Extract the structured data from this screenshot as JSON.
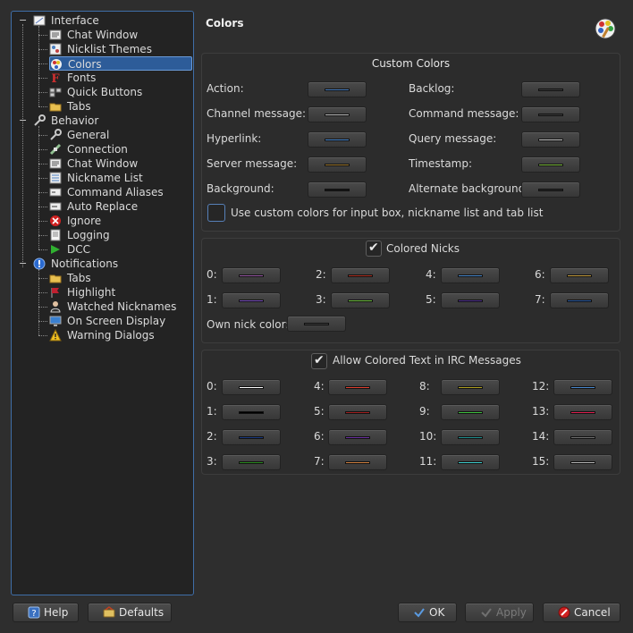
{
  "tree": {
    "items": [
      {
        "label": "Interface",
        "level": 0,
        "icon": "interface-window-icon"
      },
      {
        "label": "Chat Window",
        "level": 1,
        "icon": "chat-window-icon"
      },
      {
        "label": "Nicklist Themes",
        "level": 1,
        "icon": "nicklist-themes-icon"
      },
      {
        "label": "Colors",
        "level": 1,
        "icon": "colors-palette-icon",
        "selected": true
      },
      {
        "label": "Fonts",
        "level": 1,
        "icon": "fonts-icon"
      },
      {
        "label": "Quick Buttons",
        "level": 1,
        "icon": "quick-buttons-icon"
      },
      {
        "label": "Tabs",
        "level": 1,
        "icon": "tabs-folder-icon"
      },
      {
        "label": "Behavior",
        "level": 0,
        "icon": "wrench-icon"
      },
      {
        "label": "General",
        "level": 1,
        "icon": "wrench-icon"
      },
      {
        "label": "Connection",
        "level": 1,
        "icon": "connection-icon"
      },
      {
        "label": "Chat Window",
        "level": 1,
        "icon": "chat-window-icon"
      },
      {
        "label": "Nickname List",
        "level": 1,
        "icon": "nickname-list-icon"
      },
      {
        "label": "Command Aliases",
        "level": 1,
        "icon": "command-aliases-icon"
      },
      {
        "label": "Auto Replace",
        "level": 1,
        "icon": "auto-replace-icon"
      },
      {
        "label": "Ignore",
        "level": 1,
        "icon": "ignore-icon"
      },
      {
        "label": "Logging",
        "level": 1,
        "icon": "logging-icon"
      },
      {
        "label": "DCC",
        "level": 1,
        "icon": "dcc-arrow-icon"
      },
      {
        "label": "Notifications",
        "level": 0,
        "icon": "notifications-info-icon"
      },
      {
        "label": "Tabs",
        "level": 1,
        "icon": "tabs-folder-icon"
      },
      {
        "label": "Highlight",
        "level": 1,
        "icon": "highlight-flag-icon"
      },
      {
        "label": "Watched Nicknames",
        "level": 1,
        "icon": "watched-nicknames-icon"
      },
      {
        "label": "On Screen Display",
        "level": 1,
        "icon": "monitor-icon"
      },
      {
        "label": "Warning Dialogs",
        "level": 1,
        "icon": "warning-icon"
      }
    ]
  },
  "page": {
    "title": "Colors",
    "icon": "colors-palette-icon"
  },
  "custom_colors": {
    "title": "Custom Colors",
    "left": [
      {
        "label": "Action:",
        "color": "#4a7fc0"
      },
      {
        "label": "Channel message:",
        "color": "#c0c0c0"
      },
      {
        "label": "Hyperlink:",
        "color": "#4a8ad0"
      },
      {
        "label": "Server message:",
        "color": "#a07a30"
      },
      {
        "label": "Background:",
        "color": "#151515"
      }
    ],
    "right": [
      {
        "label": "Backlog:",
        "color": "#3a3a3a"
      },
      {
        "label": "Command message:",
        "color": "#3a3a3a"
      },
      {
        "label": "Query message:",
        "color": "#c8c8c8"
      },
      {
        "label": "Timestamp:",
        "color": "#7fbf40"
      },
      {
        "label": "Alternate background:",
        "color": "#262626"
      }
    ],
    "custom_checkbox_label": "Use custom colors for input box, nickname list and tab list",
    "custom_checkbox_checked": false
  },
  "colored_nicks": {
    "title": "Colored Nicks",
    "checked": true,
    "nicks": [
      {
        "label": "0:",
        "color": "#9a5aa8"
      },
      {
        "label": "1:",
        "color": "#7a50c0"
      },
      {
        "label": "2:",
        "color": "#b03020"
      },
      {
        "label": "3:",
        "color": "#70c040"
      },
      {
        "label": "4:",
        "color": "#4a8ad0"
      },
      {
        "label": "5:",
        "color": "#503090"
      },
      {
        "label": "6:",
        "color": "#c8a040"
      },
      {
        "label": "7:",
        "color": "#2a5aa0"
      }
    ],
    "own_label": "Own nick color:",
    "own_color": "#3a3a3a"
  },
  "irc_colors": {
    "title": "Allow Colored Text in IRC Messages",
    "checked": true,
    "colors": [
      {
        "label": "0:",
        "color": "#ffffff"
      },
      {
        "label": "1:",
        "color": "#000000"
      },
      {
        "label": "2:",
        "color": "#1a3a80"
      },
      {
        "label": "3:",
        "color": "#2a8a20"
      },
      {
        "label": "4:",
        "color": "#e04030"
      },
      {
        "label": "5:",
        "color": "#a02020"
      },
      {
        "label": "6:",
        "color": "#6a30a0"
      },
      {
        "label": "7:",
        "color": "#d08040"
      },
      {
        "label": "8:",
        "color": "#b0a020"
      },
      {
        "label": "9:",
        "color": "#40c040"
      },
      {
        "label": "10:",
        "color": "#209090"
      },
      {
        "label": "11:",
        "color": "#40d0d0"
      },
      {
        "label": "12:",
        "color": "#4a8ad0"
      },
      {
        "label": "13:",
        "color": "#e02050"
      },
      {
        "label": "14:",
        "color": "#707070"
      },
      {
        "label": "15:",
        "color": "#b8b8b8"
      }
    ]
  },
  "buttons": {
    "help": "Help",
    "defaults": "Defaults",
    "ok": "OK",
    "apply": "Apply",
    "cancel": "Cancel"
  }
}
